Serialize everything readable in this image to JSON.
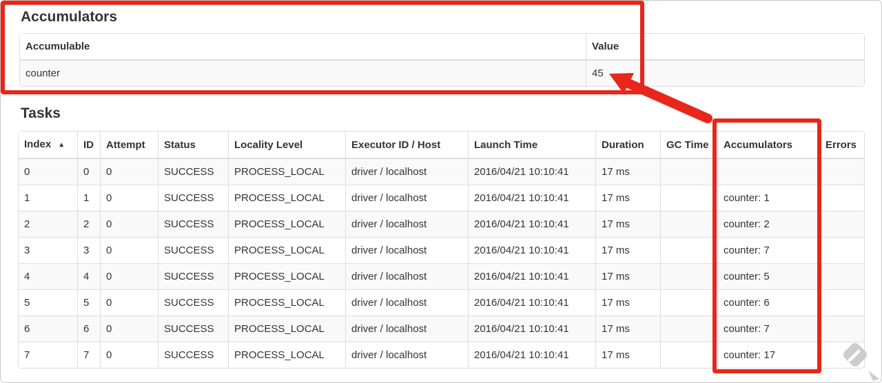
{
  "accumulators": {
    "title": "Accumulators",
    "table": {
      "headers": [
        "Accumulable",
        "Value"
      ],
      "rows": [
        [
          "counter",
          "45"
        ]
      ]
    }
  },
  "tasks": {
    "title": "Tasks",
    "table": {
      "sort_icon": "▲",
      "columns": [
        {
          "label": "Index",
          "sorted": "asc"
        },
        {
          "label": "ID"
        },
        {
          "label": "Attempt"
        },
        {
          "label": "Status"
        },
        {
          "label": "Locality Level"
        },
        {
          "label": "Executor ID / Host"
        },
        {
          "label": "Launch Time"
        },
        {
          "label": "Duration"
        },
        {
          "label": "GC Time"
        },
        {
          "label": "Accumulators"
        },
        {
          "label": "Errors"
        }
      ],
      "rows": [
        [
          "0",
          "0",
          "0",
          "SUCCESS",
          "PROCESS_LOCAL",
          "driver / localhost",
          "2016/04/21 10:10:41",
          "17 ms",
          "",
          "",
          ""
        ],
        [
          "1",
          "1",
          "0",
          "SUCCESS",
          "PROCESS_LOCAL",
          "driver / localhost",
          "2016/04/21 10:10:41",
          "17 ms",
          "",
          "counter: 1",
          ""
        ],
        [
          "2",
          "2",
          "0",
          "SUCCESS",
          "PROCESS_LOCAL",
          "driver / localhost",
          "2016/04/21 10:10:41",
          "17 ms",
          "",
          "counter: 2",
          ""
        ],
        [
          "3",
          "3",
          "0",
          "SUCCESS",
          "PROCESS_LOCAL",
          "driver / localhost",
          "2016/04/21 10:10:41",
          "17 ms",
          "",
          "counter: 7",
          ""
        ],
        [
          "4",
          "4",
          "0",
          "SUCCESS",
          "PROCESS_LOCAL",
          "driver / localhost",
          "2016/04/21 10:10:41",
          "17 ms",
          "",
          "counter: 5",
          ""
        ],
        [
          "5",
          "5",
          "0",
          "SUCCESS",
          "PROCESS_LOCAL",
          "driver / localhost",
          "2016/04/21 10:10:41",
          "17 ms",
          "",
          "counter: 6",
          ""
        ],
        [
          "6",
          "6",
          "0",
          "SUCCESS",
          "PROCESS_LOCAL",
          "driver / localhost",
          "2016/04/21 10:10:41",
          "17 ms",
          "",
          "counter: 7",
          ""
        ],
        [
          "7",
          "7",
          "0",
          "SUCCESS",
          "PROCESS_LOCAL",
          "driver / localhost",
          "2016/04/21 10:10:41",
          "17 ms",
          "",
          "counter: 17",
          ""
        ]
      ]
    }
  },
  "annotations": {
    "color": "#e8261a"
  },
  "icons": {
    "sort_ascending": "▲",
    "watermark": "feedly-logo",
    "cursor": "mouse-pointer"
  }
}
